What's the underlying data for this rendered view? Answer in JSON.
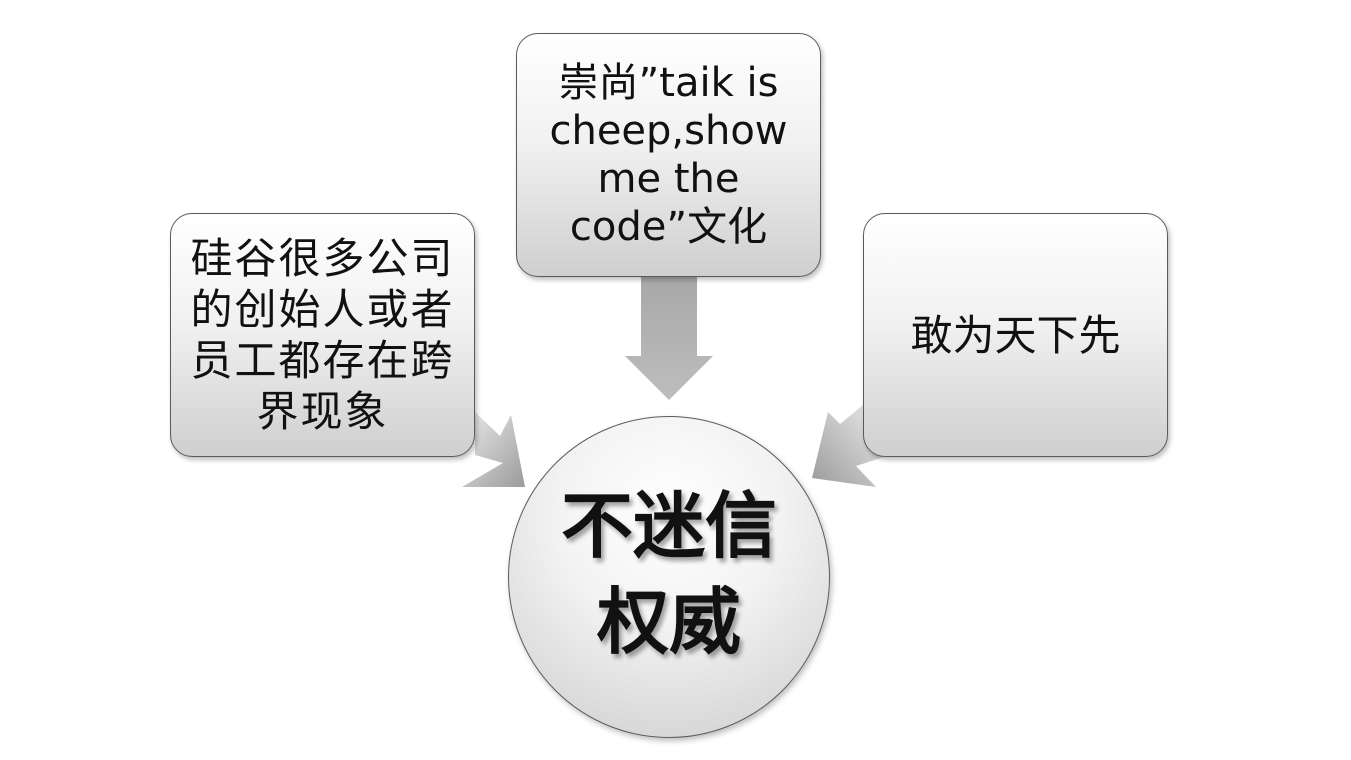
{
  "diagram": {
    "left_box": {
      "text": "硅谷很多公司的创始人或者员工都存在跨界现象"
    },
    "top_box": {
      "text": "崇尚”taik is cheep,show me the code”文化"
    },
    "right_box": {
      "text": "敢为天下先"
    },
    "center": {
      "text": "不迷信权威"
    },
    "colors": {
      "arrow_light": "#e2e2e2",
      "arrow_dark": "#9a9a9a",
      "border": "#5a5a5a"
    }
  }
}
